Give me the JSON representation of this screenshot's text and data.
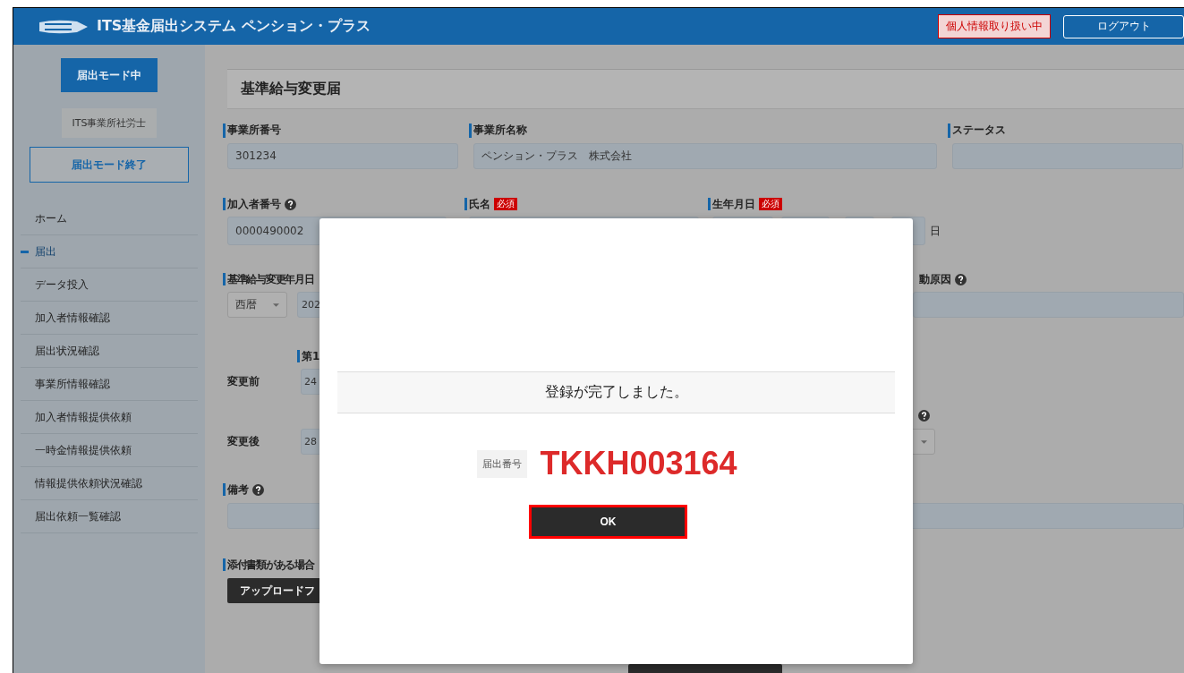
{
  "header": {
    "title": "ITS基金届出システム ペンション・プラス",
    "privacy_badge": "個人情報取り扱い中",
    "logout_button": "ログアウト"
  },
  "sidebar": {
    "mode_button": "届出モード中",
    "office_name": "ITS事業所社労士",
    "end_mode_button": "届出モード終了",
    "items": [
      {
        "label": "ホーム",
        "selected": false
      },
      {
        "label": "届出",
        "selected": true
      },
      {
        "label": "データ投入",
        "selected": false
      },
      {
        "label": "加入者情報確認",
        "selected": false
      },
      {
        "label": "届出状況確認",
        "selected": false
      },
      {
        "label": "事業所情報確認",
        "selected": false
      },
      {
        "label": "加入者情報提供依頼",
        "selected": false
      },
      {
        "label": "一時金情報提供依頼",
        "selected": false
      },
      {
        "label": "情報提供依頼状況確認",
        "selected": false
      },
      {
        "label": "届出依頼一覧確認",
        "selected": false
      }
    ]
  },
  "form": {
    "title": "基準給与変更届",
    "office_number": {
      "label": "事業所番号",
      "value": "301234"
    },
    "office_name": {
      "label": "事業所名称",
      "value": "ペンション・プラス　株式会社"
    },
    "status": {
      "label": "ステータス"
    },
    "member_number": {
      "label": "加入者番号",
      "value": "0000490002"
    },
    "name": {
      "label": "氏名",
      "required": "必須"
    },
    "birth_date": {
      "label": "生年月日",
      "required": "必須",
      "day_unit": "日"
    },
    "change_date": {
      "label": "基準給与変更年月日",
      "era": "西暦",
      "year": "202"
    },
    "change_reason": {
      "label": "動原因"
    },
    "column_label": "第1",
    "before": {
      "label": "変更前",
      "value": "24"
    },
    "after": {
      "label": "変更後",
      "value": "28"
    },
    "remarks": {
      "label": "備考"
    },
    "attachments": {
      "label": "添付書類がある場合",
      "upload_button": "アップロードフ"
    }
  },
  "modal": {
    "message": "登録が完了しました。",
    "number_label": "届出番号",
    "number": "TKKH003164",
    "ok_button": "OK"
  }
}
